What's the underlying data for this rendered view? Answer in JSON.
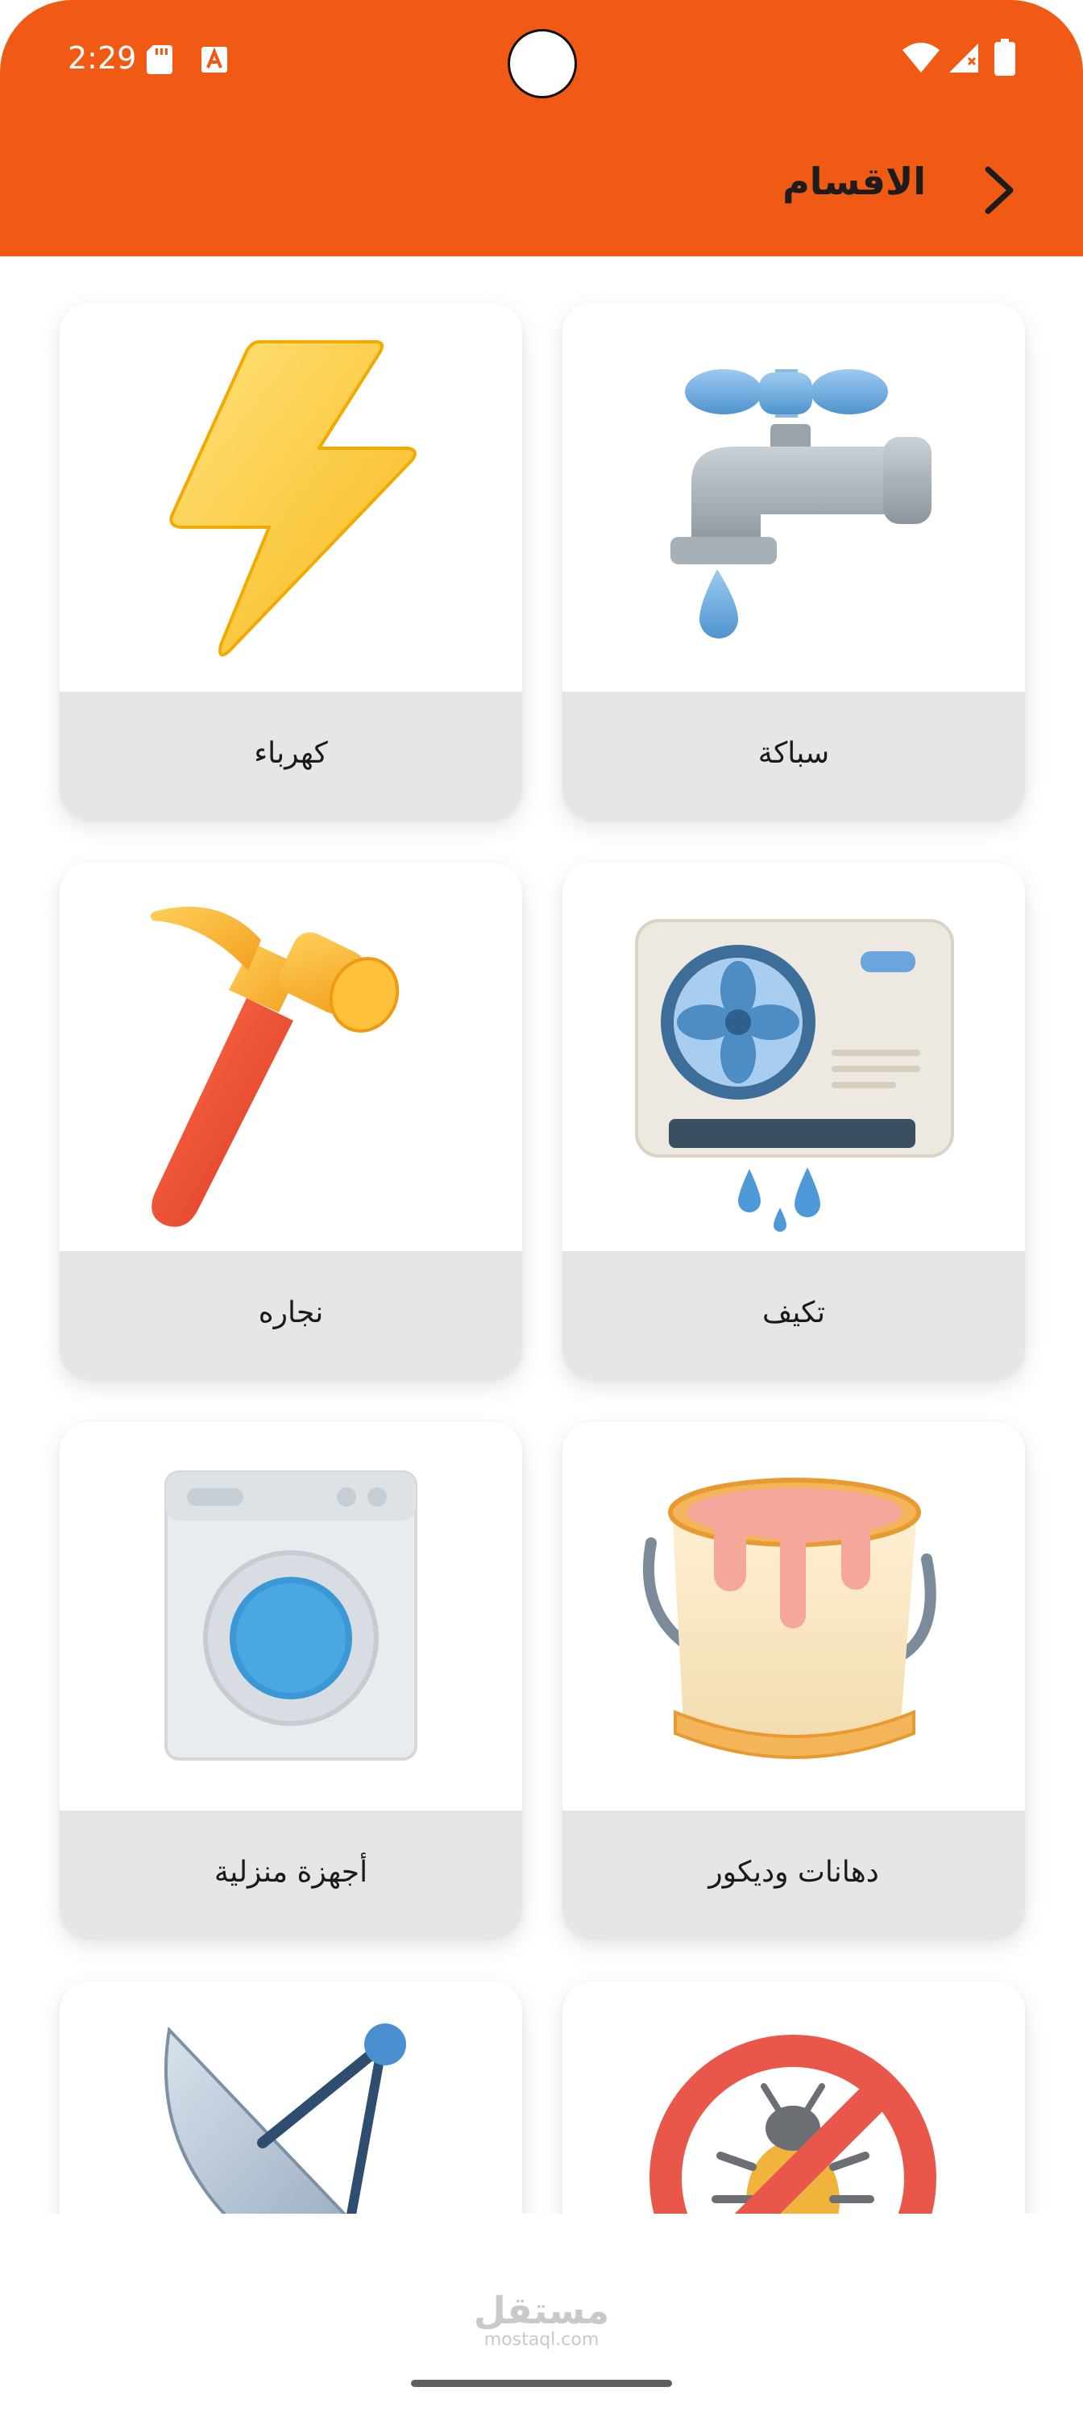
{
  "status_bar": {
    "time": "2:29"
  },
  "header": {
    "title": "الاقسام"
  },
  "categories": [
    {
      "label": "سباكة",
      "icon": "faucet-icon"
    },
    {
      "label": "كهرباء",
      "icon": "lightning-bolt-icon"
    },
    {
      "label": "تكيف",
      "icon": "air-conditioner-icon"
    },
    {
      "label": "نجاره",
      "icon": "hammer-icon"
    },
    {
      "label": "دهانات وديكور",
      "icon": "paint-bucket-icon"
    },
    {
      "label": "أجهزة منزلية",
      "icon": "washing-machine-icon"
    },
    {
      "label": "",
      "icon": "no-pest-icon"
    },
    {
      "label": "",
      "icon": "satellite-dish-icon"
    }
  ],
  "watermark": {
    "arabic": "مستقل",
    "latin": "mostaql.com"
  },
  "colors": {
    "accent": "#F05A15",
    "label_bg": "#E6E6E6"
  }
}
